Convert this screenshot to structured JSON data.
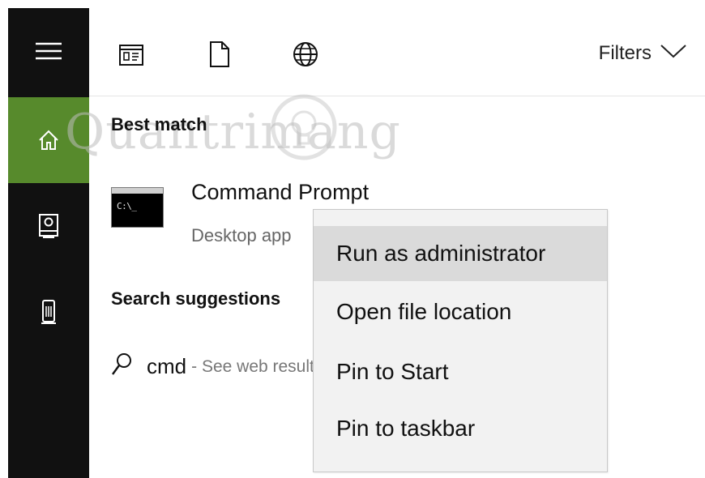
{
  "toolbar": {
    "icons": [
      "apps-icon",
      "document-icon",
      "web-icon"
    ],
    "filters_label": "Filters"
  },
  "rail": {
    "items": [
      "menu-icon",
      "home-icon",
      "notebook-icon",
      "tower-icon"
    ],
    "active": "home-icon",
    "accent_color": "#578a2c"
  },
  "results": {
    "best_match_heading": "Best match",
    "app_name": "Command Prompt",
    "app_type": "Desktop app",
    "suggestions_heading": "Search suggestions",
    "suggestion_term": "cmd",
    "suggestion_hint": "- See web results"
  },
  "context_menu": {
    "items": [
      "Run as administrator",
      "Open file location",
      "Pin to Start",
      "Pin to taskbar"
    ],
    "highlighted_index": 0
  },
  "watermark": {
    "text": "Quantrimang"
  }
}
